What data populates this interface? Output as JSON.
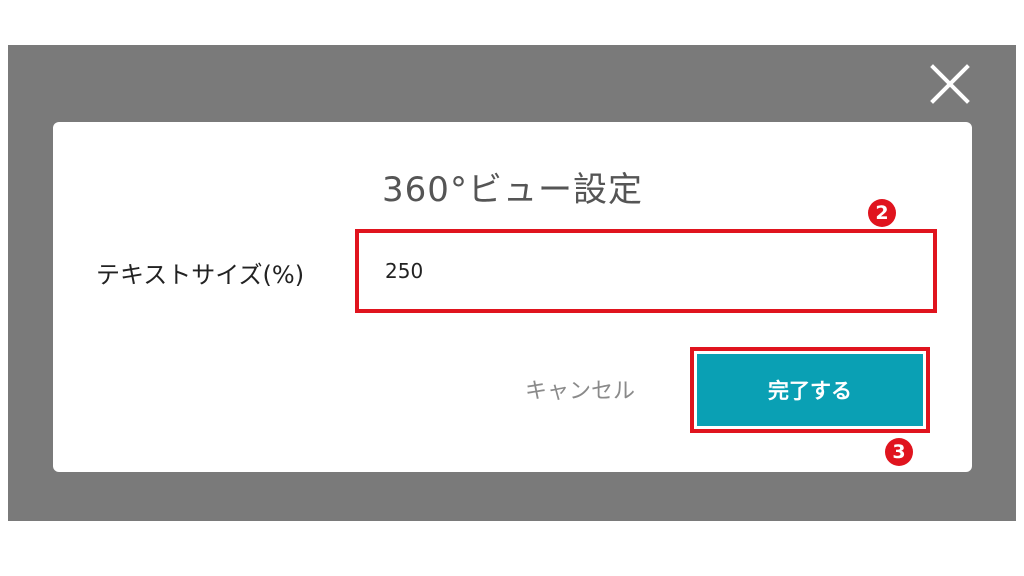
{
  "overlay": {
    "close_icon": "close-icon"
  },
  "dialog": {
    "title": "360°ビュー設定",
    "field": {
      "label": "テキストサイズ(%)",
      "value": "250"
    },
    "buttons": {
      "cancel_label": "キャンセル",
      "done_label": "完了する"
    }
  },
  "annotations": {
    "marker_input": "2",
    "marker_done": "3"
  },
  "colors": {
    "overlay": "#7a7a7a",
    "accent": "#0aa0b4",
    "highlight": "#e0141e"
  }
}
